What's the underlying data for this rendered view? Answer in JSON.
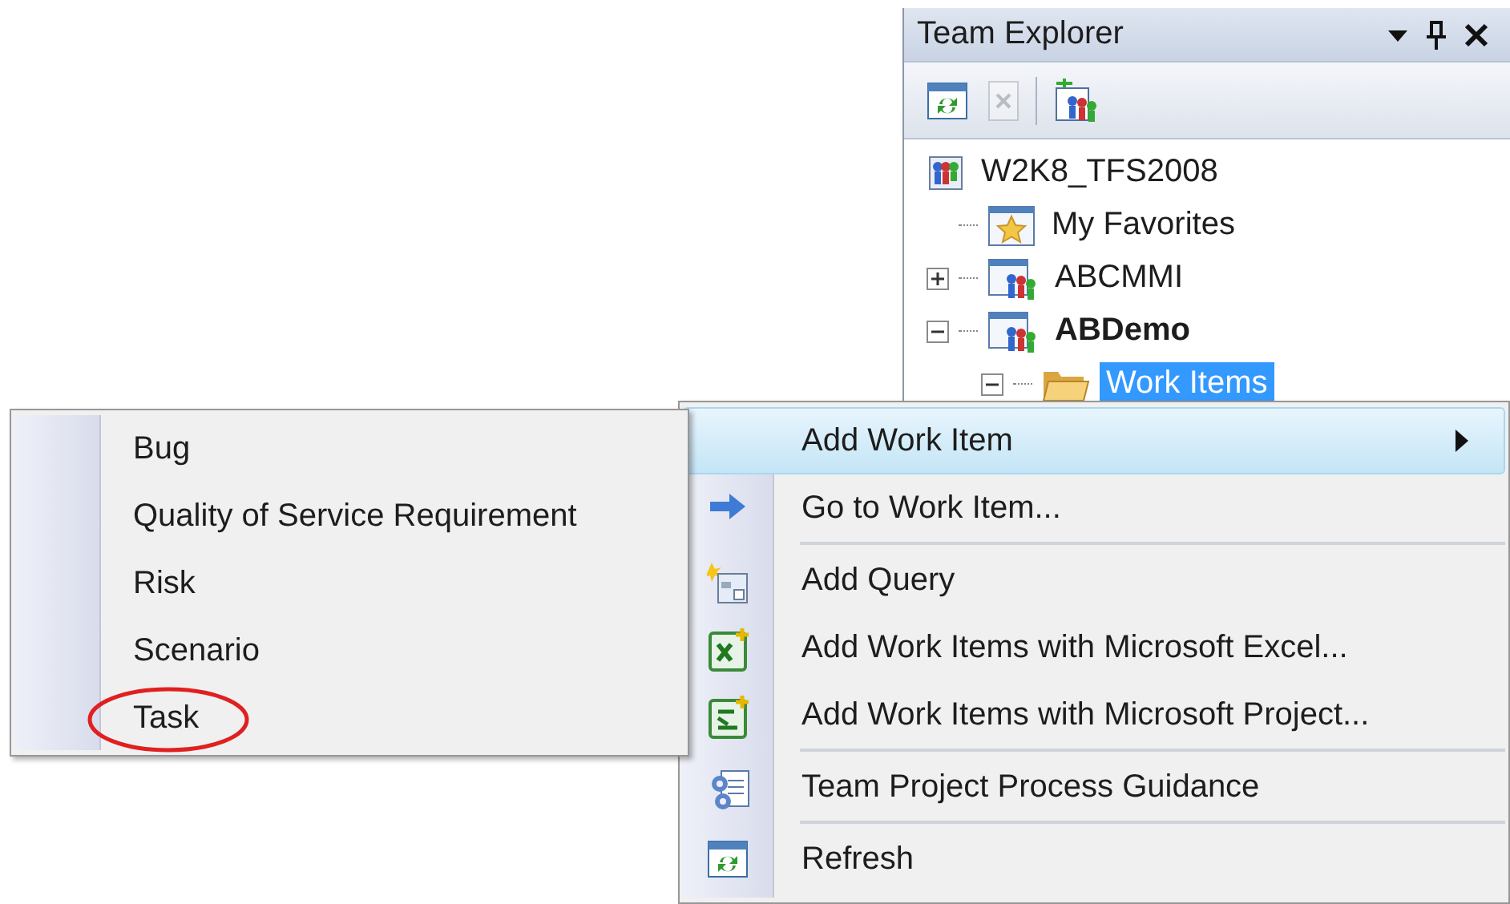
{
  "team_explorer": {
    "title": "Team Explorer",
    "toolbar": [
      {
        "kind": "refresh",
        "disabled": false
      },
      {
        "kind": "delete",
        "disabled": true
      },
      {
        "kind": "add",
        "disabled": false
      }
    ],
    "tree": [
      {
        "label": "W2K8_TFS2008",
        "kind": "server",
        "selected": false,
        "active": false,
        "children": [
          {
            "label": "My Favorites",
            "kind": "favorites",
            "selected": false,
            "active": false
          },
          {
            "label": "ABCMMI",
            "kind": "project",
            "expanded": false,
            "selected": false,
            "active": false
          },
          {
            "label": "ABDemo",
            "kind": "project",
            "expanded": true,
            "selected": false,
            "active": true,
            "children": [
              {
                "label": "Work Items",
                "kind": "folder",
                "expanded": true,
                "selected": true,
                "active": false
              }
            ]
          }
        ]
      }
    ]
  },
  "context_menu": {
    "items": [
      {
        "label": "Add Work Item",
        "kind": "none",
        "selected": true,
        "has_submenu": true,
        "separator_after": false
      },
      {
        "label": "Go to Work Item...",
        "kind": "arrow",
        "selected": false,
        "has_submenu": false,
        "separator_after": true
      },
      {
        "label": "Add Query",
        "kind": "query",
        "selected": false,
        "has_submenu": false,
        "separator_after": false
      },
      {
        "label": "Add Work Items with Microsoft Excel...",
        "kind": "excel",
        "selected": false,
        "has_submenu": false,
        "separator_after": false
      },
      {
        "label": "Add Work Items with Microsoft Project...",
        "kind": "project",
        "selected": false,
        "has_submenu": false,
        "separator_after": true
      },
      {
        "label": "Team Project Process Guidance",
        "kind": "guidance",
        "selected": false,
        "has_submenu": false,
        "separator_after": true
      },
      {
        "label": "Refresh",
        "kind": "refresh",
        "selected": false,
        "has_submenu": false,
        "separator_after": false
      }
    ]
  },
  "submenu": {
    "items": [
      {
        "label": "Bug",
        "circled": false
      },
      {
        "label": "Quality of Service Requirement",
        "circled": false
      },
      {
        "label": "Risk",
        "circled": false
      },
      {
        "label": "Scenario",
        "circled": false
      },
      {
        "label": "Task",
        "circled": true
      }
    ]
  }
}
